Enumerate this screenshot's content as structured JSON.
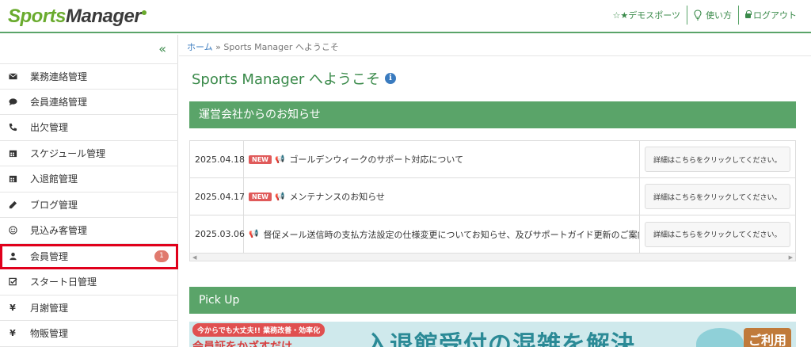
{
  "header": {
    "logo_left": "Sports",
    "logo_right": "Manager",
    "nav": {
      "demo": "☆★デモスポーツ",
      "howto": "使い方",
      "logout": "ログアウト"
    }
  },
  "sidebar": {
    "collapse_label": "«",
    "items": [
      {
        "label": "業務連絡管理",
        "icon": "envelope-icon"
      },
      {
        "label": "会員連絡管理",
        "icon": "comment-icon"
      },
      {
        "label": "出欠管理",
        "icon": "phone-icon"
      },
      {
        "label": "スケジュール管理",
        "icon": "calendar-icon"
      },
      {
        "label": "入退館管理",
        "icon": "calendar-icon"
      },
      {
        "label": "ブログ管理",
        "icon": "pencil-icon"
      },
      {
        "label": "見込み客管理",
        "icon": "smile-icon"
      },
      {
        "label": "会員管理",
        "icon": "user-icon",
        "badge": "1"
      },
      {
        "label": "スタート日管理",
        "icon": "checkbox-icon"
      },
      {
        "label": "月謝管理",
        "icon": "yen-icon"
      },
      {
        "label": "物販管理",
        "icon": "yen-icon"
      }
    ]
  },
  "breadcrumb": {
    "home": "ホーム",
    "sep": "»",
    "current": "Sports Manager へようこそ"
  },
  "page_title": "Sports Manager へようこそ",
  "notices": {
    "heading": "運営会社からのお知らせ",
    "new_label": "NEW",
    "rows": [
      {
        "date": "2025.04.18",
        "is_new": true,
        "title": "ゴールデンウィークのサポート対応について",
        "button": "詳細はこちらをクリックしてください。"
      },
      {
        "date": "2025.04.17",
        "is_new": true,
        "title": "メンテナンスのお知らせ",
        "button": "詳細はこちらをクリックしてください。"
      },
      {
        "date": "2025.03.06",
        "is_new": false,
        "title": "督促メール送信時の支払方法設定の仕様変更についてお知らせ、及びサポートガイド更新のご案内",
        "button": "詳細はこちらをクリックしてください。"
      }
    ]
  },
  "pickup": {
    "heading": "Pick Up",
    "banner_tag": "今からでも大丈夫!! 業務改善・効率化",
    "banner_sub": "会員証をかざすだけ",
    "banner_main": "入退館受付の混雑を解決",
    "banner_right": "ご利用"
  },
  "colors": {
    "brand_green": "#5aa469",
    "active_outline": "#e0001b",
    "badge": "#e07a6e",
    "new_badge": "#e05a5a"
  }
}
